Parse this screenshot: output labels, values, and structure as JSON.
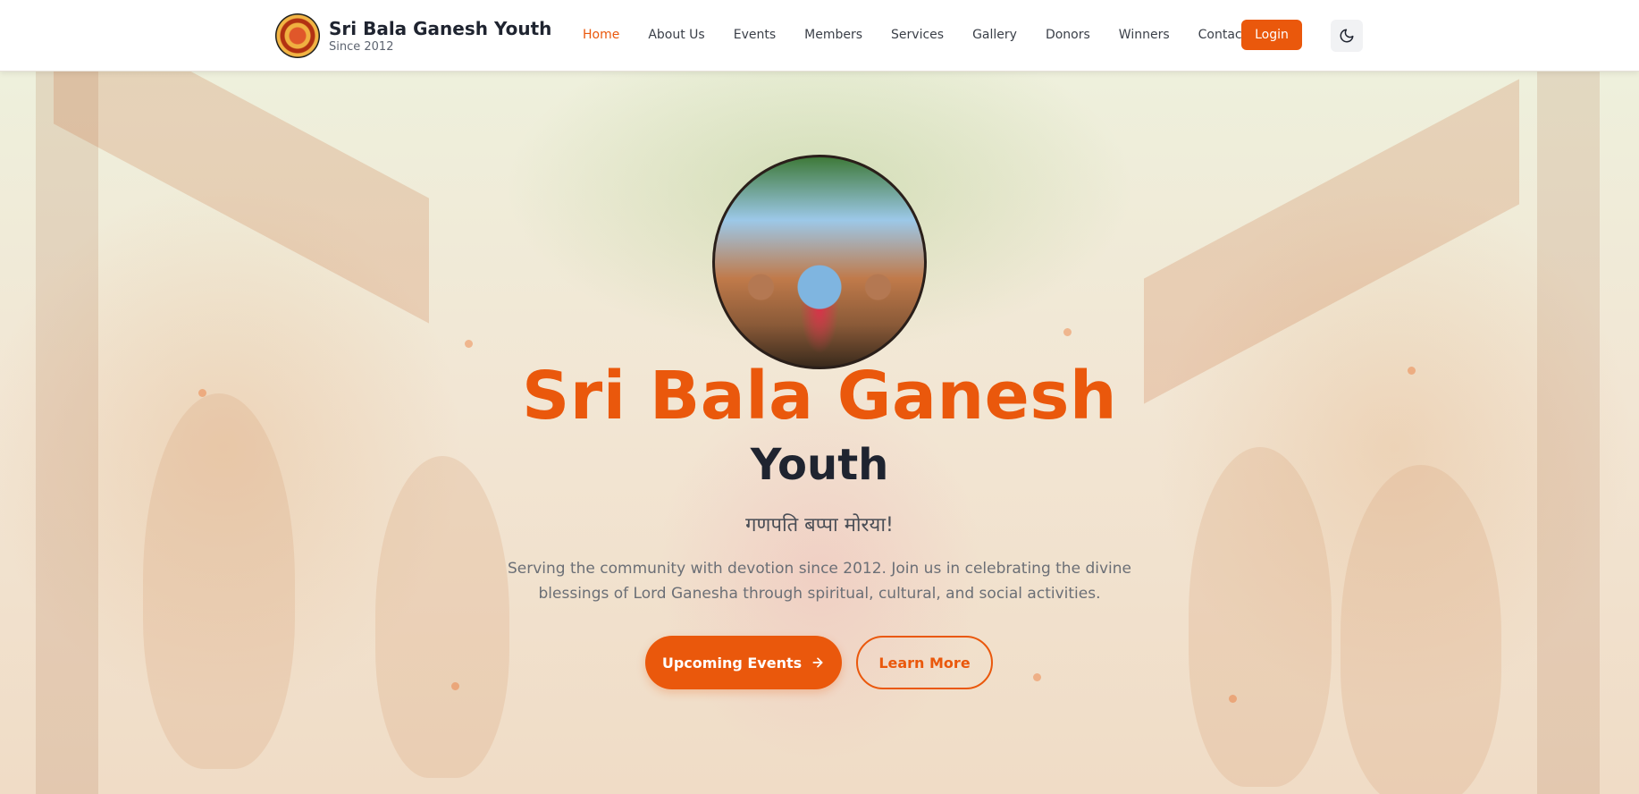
{
  "header": {
    "brand_title": "Sri Bala Ganesh Youth",
    "brand_subtitle": "Since 2012",
    "nav": [
      {
        "label": "Home",
        "active": true
      },
      {
        "label": "About Us"
      },
      {
        "label": "Events"
      },
      {
        "label": "Members"
      },
      {
        "label": "Services"
      },
      {
        "label": "Gallery"
      },
      {
        "label": "Donors"
      },
      {
        "label": "Winners"
      },
      {
        "label": "Contact"
      }
    ],
    "login_label": "Login",
    "theme_icon": "moon-icon"
  },
  "hero": {
    "title": "Sri Bala Ganesh",
    "subtitle": "Youth",
    "tagline": "गणपति बप्पा मोरया!",
    "description": "Serving the community with devotion since 2012. Join us in celebrating the divine blessings of Lord Ganesha through spiritual, cultural, and social activities.",
    "primary_button": "Upcoming Events",
    "secondary_button": "Learn More"
  },
  "colors": {
    "accent": "#ea580c",
    "heading": "#1f2430",
    "header_bg": "#ffffff"
  }
}
